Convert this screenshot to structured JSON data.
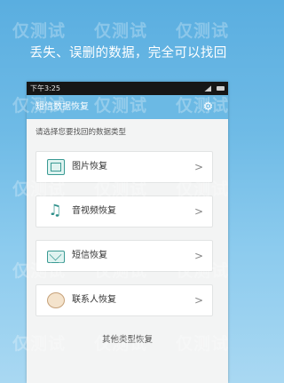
{
  "headline": "丢失、误删的数据，完全可以找回",
  "status_bar": {
    "time": "下午3:25"
  },
  "app_bar": {
    "title": "短信数据恢复"
  },
  "prompt": "请选择您要找回的数据类型",
  "items": [
    {
      "label": "图片恢复",
      "icon": "image-icon"
    },
    {
      "label": "音视频恢复",
      "icon": "music-note-icon"
    },
    {
      "label": "短信恢复",
      "icon": "envelope-icon"
    },
    {
      "label": "联系人恢复",
      "icon": "contact-icon"
    }
  ],
  "chevron": ">",
  "other": "其他类型恢复",
  "watermark_text": "仅测试",
  "colors": {
    "background": "#6fbbe6",
    "app_bar": "#6bb9e4",
    "icon_accent": "#3a9a93"
  }
}
